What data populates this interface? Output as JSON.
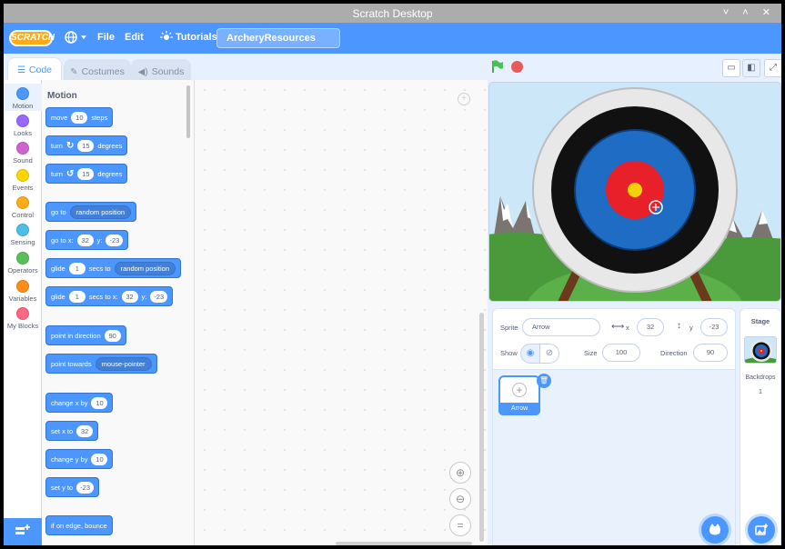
{
  "window": {
    "title": "Scratch Desktop",
    "controls": "˅ ˄ ✕"
  },
  "menubar": {
    "logo": "SCRATCH",
    "file": "File",
    "edit": "Edit",
    "tutorials": "Tutorials",
    "project_title": "ArcheryResources"
  },
  "tabs": {
    "code": "Code",
    "costumes": "Costumes",
    "sounds": "Sounds"
  },
  "categories": [
    {
      "label": "Motion",
      "color": "#4c97ff"
    },
    {
      "label": "Looks",
      "color": "#9966ff"
    },
    {
      "label": "Sound",
      "color": "#cf63cf"
    },
    {
      "label": "Events",
      "color": "#ffd500"
    },
    {
      "label": "Control",
      "color": "#ffab19"
    },
    {
      "label": "Sensing",
      "color": "#4cbfe6"
    },
    {
      "label": "Operators",
      "color": "#59c059"
    },
    {
      "label": "Variables",
      "color": "#ff8c1a"
    },
    {
      "label": "My Blocks",
      "color": "#ff6680"
    }
  ],
  "palette": {
    "title": "Motion",
    "blocks": {
      "move": {
        "a": "move",
        "v": "10",
        "b": "steps"
      },
      "turn_right": {
        "a": "turn",
        "v": "15",
        "b": "degrees"
      },
      "turn_left": {
        "a": "turn",
        "v": "15",
        "b": "degrees"
      },
      "goto": {
        "a": "go to",
        "dd": "random position"
      },
      "gotoxy": {
        "a": "go to x:",
        "x": "32",
        "b": "y:",
        "y": "-23"
      },
      "glide_to": {
        "a": "glide",
        "v": "1",
        "b": "secs to",
        "dd": "random position"
      },
      "glide_xy": {
        "a": "glide",
        "v": "1",
        "b": "secs to x:",
        "x": "32",
        "c": "y:",
        "y": "-23"
      },
      "point_dir": {
        "a": "point in direction",
        "v": "90"
      },
      "point_towards": {
        "a": "point towards",
        "dd": "mouse-pointer"
      },
      "change_x": {
        "a": "change x by",
        "v": "10"
      },
      "set_x": {
        "a": "set x to",
        "v": "32"
      },
      "change_y": {
        "a": "change y by",
        "v": "10"
      },
      "set_y": {
        "a": "set y to",
        "v": "-23"
      },
      "bounce": {
        "a": "if on edge, bounce"
      }
    }
  },
  "sprite": {
    "sprite_label": "Sprite",
    "name": "Arrow",
    "x_label": "x",
    "x": "32",
    "y_label": "y",
    "y": "-23",
    "show_label": "Show",
    "size_label": "Size",
    "size": "100",
    "direction_label": "Direction",
    "direction": "90",
    "card_name": "Arrow"
  },
  "stage_panel": {
    "title": "Stage",
    "backdrops_label": "Backdrops",
    "backdrops_count": "1"
  }
}
